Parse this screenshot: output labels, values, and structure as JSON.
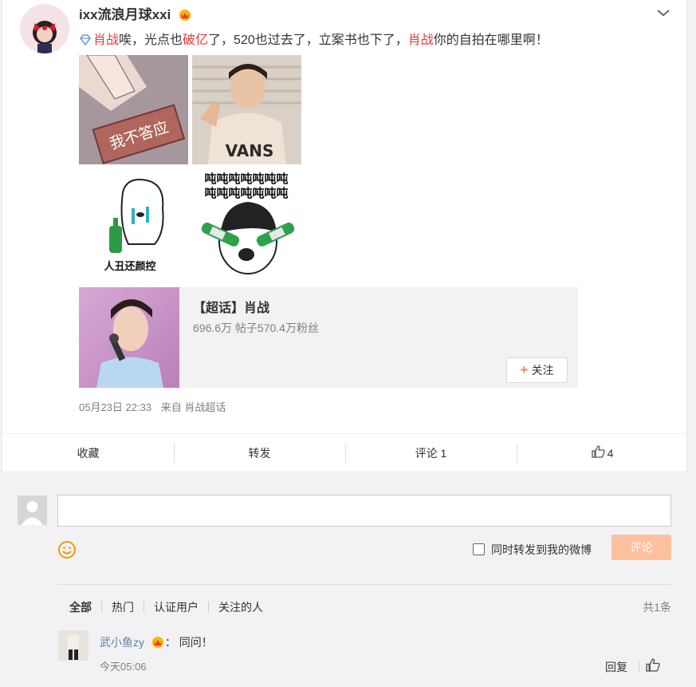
{
  "post": {
    "username": "ixx流浪月球xxi",
    "text_parts": [
      "肖战",
      "唉，光点也",
      "破亿",
      "了，520也过去了，立案书也下了，",
      "肖战",
      "你的自拍在哪里啊！"
    ],
    "images": [
      {
        "caption": "我不答应"
      },
      {
        "caption": "VANS"
      },
      {
        "caption": "人丑还颜控"
      },
      {
        "caption": "吨吨吨吨吨吨吨"
      }
    ],
    "topic": {
      "title": "【超话】肖战",
      "stats": "696.6万 帖子570.4万粉丝",
      "follow_label": "关注"
    },
    "date": "05月23日 22:33",
    "source": "来自 肖战超话"
  },
  "actions": {
    "favorite": "收藏",
    "repost": "转发",
    "comment": "评论 1",
    "like_count": "4"
  },
  "composer": {
    "placeholder": "",
    "repost_label": "同时转发到我的微博",
    "submit_label": "评论"
  },
  "comments_filter": {
    "tabs": [
      "全部",
      "热门",
      "认证用户",
      "关注的人"
    ],
    "total": "共1条"
  },
  "comment": {
    "user": "武小鱼zy",
    "text": "：  同问！",
    "time": "今天05:06",
    "reply_label": "回复"
  },
  "colors": {
    "accent": "#ff8140",
    "link": "#5d7eaa",
    "highlight": "#e8393a",
    "submit_disabled": "#ffc09f"
  }
}
